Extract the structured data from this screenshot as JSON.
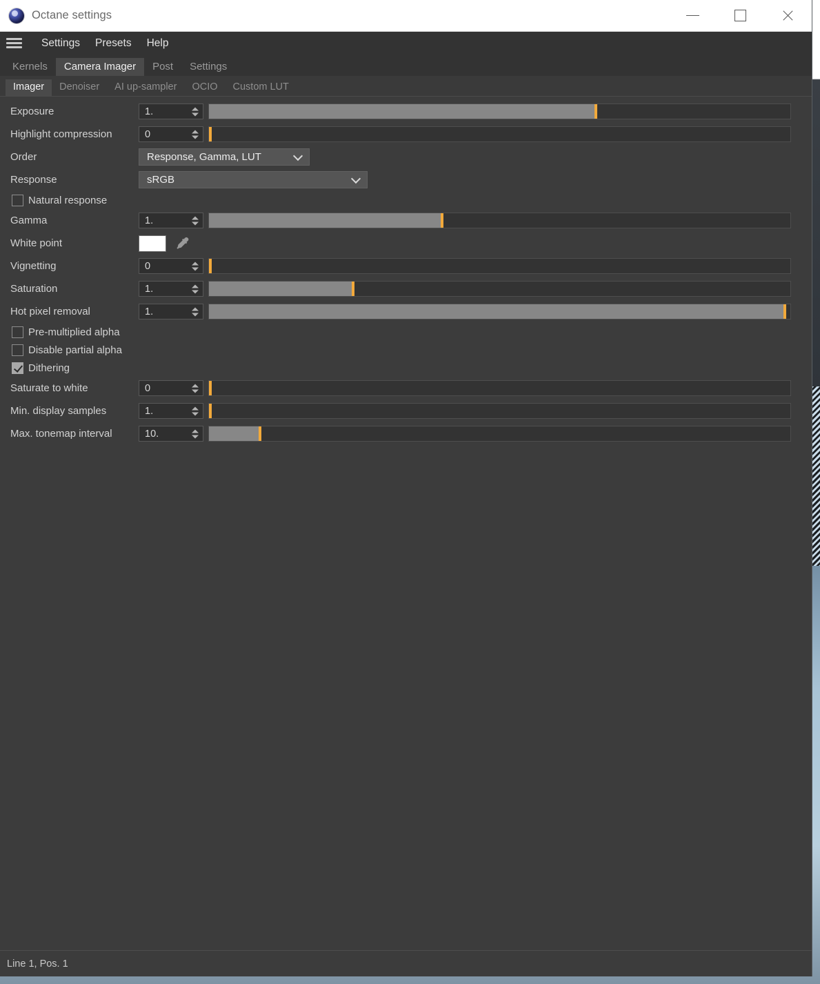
{
  "window": {
    "title": "Octane settings",
    "logo_icon": "octane-logo-icon",
    "controls": {
      "minimize": "minimize-icon",
      "maximize": "maximize-icon",
      "close": "close-icon"
    }
  },
  "menu_bar": {
    "hamburger_icon": "hamburger-icon",
    "items": [
      {
        "label": "Settings"
      },
      {
        "label": "Presets"
      },
      {
        "label": "Help"
      }
    ]
  },
  "main_tabs": [
    {
      "label": "Kernels",
      "active": false
    },
    {
      "label": "Camera Imager",
      "active": true
    },
    {
      "label": "Post",
      "active": false
    },
    {
      "label": "Settings",
      "active": false
    }
  ],
  "sub_tabs": [
    {
      "label": "Imager",
      "active": true
    },
    {
      "label": "Denoiser",
      "active": false
    },
    {
      "label": "AI up-sampler",
      "active": false
    },
    {
      "label": "OCIO",
      "active": false
    },
    {
      "label": "Custom LUT",
      "active": false
    }
  ],
  "settings": {
    "exposure": {
      "label": "Exposure",
      "value": "1.",
      "fill_pct": 66.8
    },
    "highlight_compression": {
      "label": "Highlight compression",
      "value": "0",
      "fill_pct": 0
    },
    "order": {
      "label": "Order",
      "value": "Response, Gamma, LUT"
    },
    "response": {
      "label": "Response",
      "value": "sRGB"
    },
    "natural_response": {
      "label": "Natural response",
      "checked": false
    },
    "gamma": {
      "label": "Gamma",
      "value": "1.",
      "fill_pct": 39.8
    },
    "white_point": {
      "label": "White point",
      "color": "#ffffff",
      "picker_icon": "eyedropper-icon"
    },
    "vignetting": {
      "label": "Vignetting",
      "value": "0",
      "fill_pct": 0
    },
    "saturation": {
      "label": "Saturation",
      "value": "1.",
      "fill_pct": 24.6
    },
    "hot_pixel_removal": {
      "label": "Hot pixel removal",
      "value": "1.",
      "fill_pct": 99.3
    },
    "pre_multiplied_alpha": {
      "label": "Pre-multiplied alpha",
      "checked": false
    },
    "disable_partial_alpha": {
      "label": "Disable partial alpha",
      "checked": false
    },
    "dithering": {
      "label": "Dithering",
      "checked": true
    },
    "saturate_to_white": {
      "label": "Saturate to white",
      "value": "0",
      "fill_pct": 0
    },
    "min_display_samples": {
      "label": "Min. display samples",
      "value": "1.",
      "fill_pct": 0
    },
    "max_tonemap_interval": {
      "label": "Max. tonemap interval",
      "value": "10.",
      "fill_pct": 8.6
    }
  },
  "status_bar": {
    "text": "Line 1, Pos. 1"
  },
  "colors": {
    "accent": "#f2a93b",
    "slider_fill": "#878787",
    "panel_bg": "#3c3c3c",
    "titlebar_bg": "#ffffff"
  }
}
